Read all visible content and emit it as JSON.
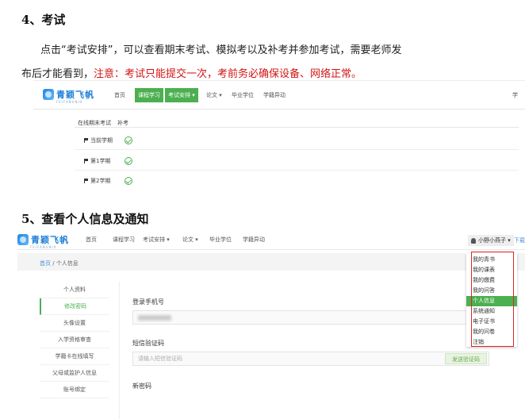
{
  "section4": {
    "heading": "4、考试",
    "line1": "点击“考试安排”，可以查看期末考试、模拟考以及补考并参加考试，需要老师发",
    "line2_normal": "布后才能看到，",
    "line2_red": "注意：考试只能提交一次，考前务必确保设备、网络正常。",
    "screenshot": {
      "logo_text": "青颖飞帆",
      "logo_sub": "FEIFANUNIX",
      "nav": [
        "首页",
        "课程学习",
        "考试安排 ▾",
        "论文 ▾",
        "毕业学位",
        "学籍异动"
      ],
      "nav_active_index": 2,
      "nav_right": "学",
      "tabs": [
        "在线期末考试",
        "补考"
      ],
      "terms": [
        "当前学期",
        "第1学期",
        "第2学期"
      ]
    }
  },
  "section5": {
    "heading": "5、查看个人信息及通知",
    "screenshot": {
      "logo_text": "青颖飞帆",
      "logo_sub": "FEIFANUNIX",
      "nav": [
        "首页",
        "课程学习",
        "考试安排 ▾",
        "论文 ▾",
        "毕业学位",
        "学籍异动"
      ],
      "user": "小野小燕子 ▾",
      "download": "下载",
      "breadcrumb": {
        "home": "首页",
        "sep": " / ",
        "current": "个人信息"
      },
      "left_nav": [
        "个人资料",
        "修改密码",
        "头像设置",
        "入学资格审查",
        "学籍卡在线填写",
        "父母或监护人信息",
        "账号绑定"
      ],
      "left_nav_active_index": 1,
      "form": {
        "phone_label": "登录手机号",
        "sms_label": "短信验证码",
        "sms_placeholder": "请输入短信验证码",
        "send_button": "发送验证码",
        "new_password_label": "新密码"
      },
      "dropdown": [
        "我的青书",
        "我的课表",
        "我的缴费",
        "我的问答",
        "个人信息",
        "系统通知",
        "电子证书",
        "我的问卷",
        "注销"
      ],
      "dropdown_active_index": 4
    }
  },
  "colors": {
    "accent_green": "#4caf50",
    "highlight_red": "#d21414",
    "link_blue": "#4a90d9"
  }
}
